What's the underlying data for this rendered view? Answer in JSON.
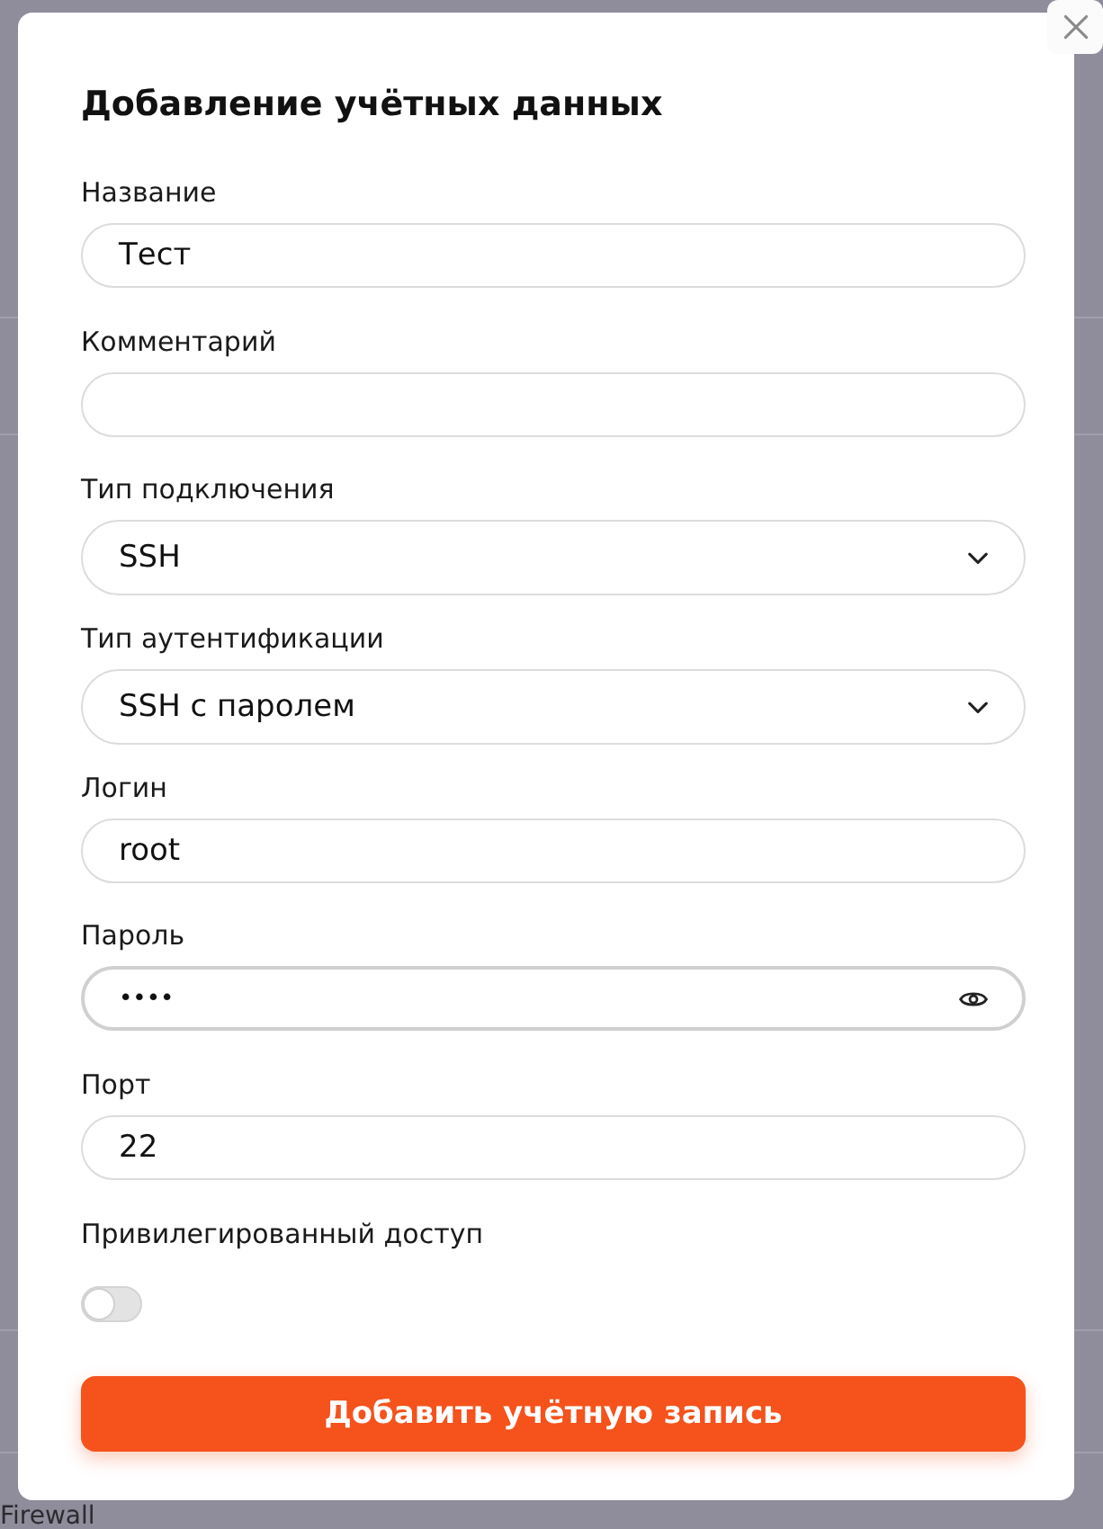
{
  "dialog": {
    "title": "Добавление учётных данных"
  },
  "fields": [
    {
      "kind": "text",
      "label": "Название",
      "value": "Тест",
      "focused": false
    },
    {
      "kind": "text",
      "label": "Комментарий",
      "focused": false
    },
    {
      "kind": "select",
      "label": "Тип подключения",
      "value": "SSH",
      "focused": false
    },
    {
      "kind": "select",
      "label": "Тип аутентификации",
      "value": "SSH с паролем",
      "focused": false
    },
    {
      "kind": "text",
      "label": "Логин",
      "value": "root",
      "focused": false
    },
    {
      "kind": "password",
      "label": "Пароль",
      "value": "••••",
      "focused": true
    },
    {
      "kind": "text",
      "label": "Порт",
      "value": "22",
      "focused": false
    },
    {
      "kind": "toggle",
      "label": "Привилегированный доступ",
      "on": false
    }
  ],
  "submit_button": "Добавить учётную запись",
  "backdrop": {
    "texts": [
      "Firewall"
    ]
  }
}
